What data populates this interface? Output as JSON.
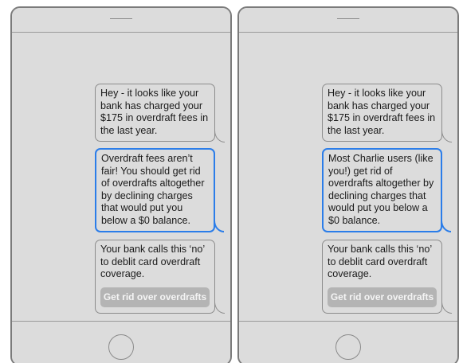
{
  "phones": [
    {
      "messages": [
        {
          "text": "Hey - it looks like your\nbank has charged your\n$175 in overdraft fees in\nthe last year."
        },
        {
          "text": "Overdraft fees aren’t\nfair! You should get rid\nof overdrafts altogether\nby declining charges\nthat would put you\nbelow a $0 balance."
        },
        {
          "text": "Your bank calls this ‘no’\nto deblit card overdraft\ncoverage.",
          "button_label": "Get rid over overdrafts"
        }
      ]
    },
    {
      "messages": [
        {
          "text": "Hey - it looks like your\nbank has charged your\n$175 in overdraft fees in\nthe last year."
        },
        {
          "text": "Most Charlie users (like\nyou!) get rid of\noverdrafts altogether by\ndeclining charges that\nwould put you below a\n$0 balance."
        },
        {
          "text": "Your bank calls this ‘no’\nto deblit card overdraft\ncoverage.",
          "button_label": "Get rid over overdrafts"
        }
      ]
    }
  ],
  "colors": {
    "phone_background": "#dcdcdc",
    "phone_frame": "#7b7b7b",
    "highlight_border": "#2b7de9",
    "button_background": "#b4b4b4",
    "button_text": "#f4f4f4"
  }
}
